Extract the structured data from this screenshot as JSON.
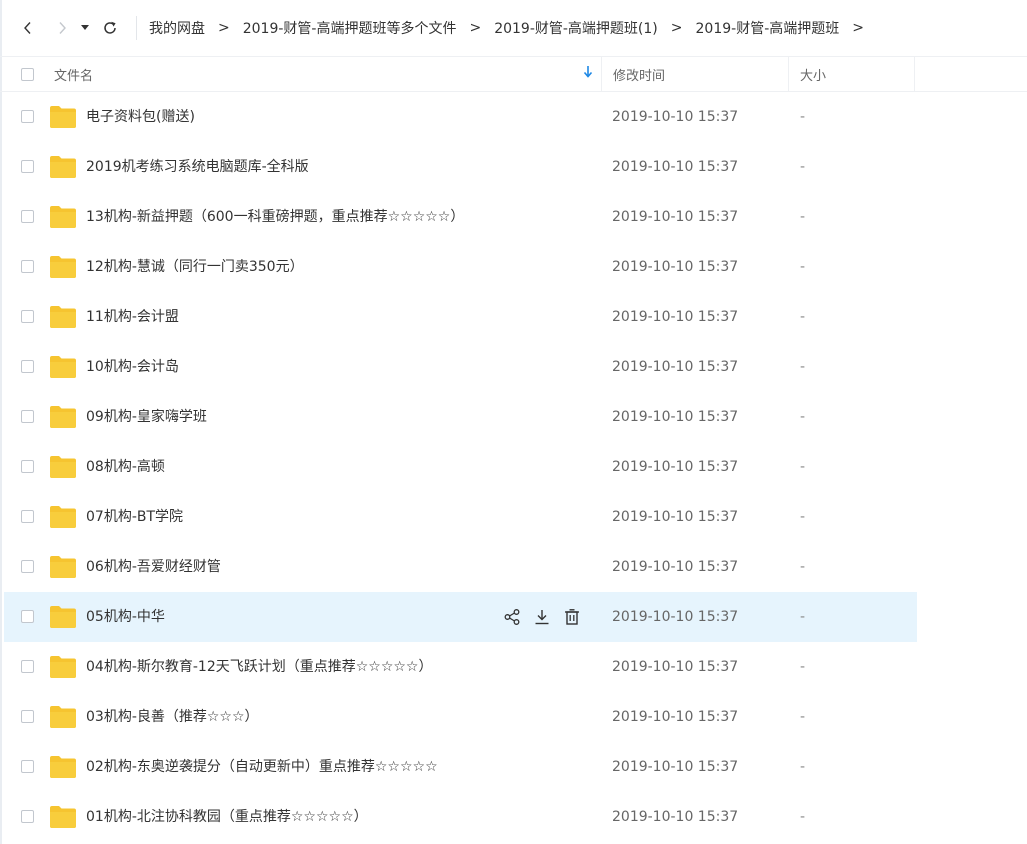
{
  "breadcrumb": {
    "items": [
      "我的网盘",
      "2019-财管-高端押题班等多个文件",
      "2019-财管-高端押题班(1)",
      "2019-财管-高端押题班"
    ],
    "separator": ">"
  },
  "columns": {
    "name": "文件名",
    "modified": "修改时间",
    "size": "大小"
  },
  "colors": {
    "accent": "#1e88e5",
    "folder": "#f6c430",
    "hover_row": "#e6f4fd"
  },
  "files": [
    {
      "name": "电子资料包(赠送)",
      "modified": "2019-10-10 15:37",
      "size": "-"
    },
    {
      "name": "2019机考练习系统电脑题库-全科版",
      "modified": "2019-10-10 15:37",
      "size": "-"
    },
    {
      "name": "13机构-新益押题（600一科重磅押题，重点推荐☆☆☆☆☆）",
      "modified": "2019-10-10 15:37",
      "size": "-"
    },
    {
      "name": "12机构-慧诚（同行一门卖350元）",
      "modified": "2019-10-10 15:37",
      "size": "-"
    },
    {
      "name": "11机构-会计盟",
      "modified": "2019-10-10 15:37",
      "size": "-"
    },
    {
      "name": "10机构-会计岛",
      "modified": "2019-10-10 15:37",
      "size": "-"
    },
    {
      "name": "09机构-皇家嗨学班",
      "modified": "2019-10-10 15:37",
      "size": "-"
    },
    {
      "name": "08机构-高顿",
      "modified": "2019-10-10 15:37",
      "size": "-"
    },
    {
      "name": "07机构-BT学院",
      "modified": "2019-10-10 15:37",
      "size": "-"
    },
    {
      "name": "06机构-吾爱财经财管",
      "modified": "2019-10-10 15:37",
      "size": "-"
    },
    {
      "name": "05机构-中华",
      "modified": "2019-10-10 15:37",
      "size": "-"
    },
    {
      "name": "04机构-斯尔教育-12天飞跃计划（重点推荐☆☆☆☆☆）",
      "modified": "2019-10-10 15:37",
      "size": "-"
    },
    {
      "name": "03机构-良善（推荐☆☆☆）",
      "modified": "2019-10-10 15:37",
      "size": "-"
    },
    {
      "name": "02机构-东奥逆袭提分（自动更新中）重点推荐☆☆☆☆☆",
      "modified": "2019-10-10 15:37",
      "size": "-"
    },
    {
      "name": "01机构-北注协科教园（重点推荐☆☆☆☆☆）",
      "modified": "2019-10-10 15:37",
      "size": "-"
    }
  ],
  "hovered_row_index": 10,
  "row_action_icons": [
    "share-icon",
    "download-icon",
    "delete-icon"
  ]
}
